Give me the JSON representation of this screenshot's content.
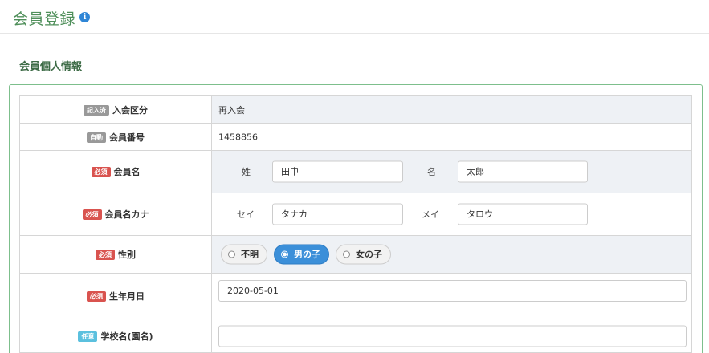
{
  "header": {
    "title": "会員登録",
    "info_icon": "info-icon"
  },
  "section": {
    "title": "会員個人情報"
  },
  "rows": {
    "member_type": {
      "badge": "記入済",
      "label": "入会区分",
      "value": "再入会"
    },
    "member_no": {
      "badge": "自動",
      "label": "会員番号",
      "value": "1458856"
    },
    "name": {
      "badge": "必須",
      "label": "会員名",
      "last_label": "姓",
      "last_value": "田中",
      "first_label": "名",
      "first_value": "太郎"
    },
    "kana": {
      "badge": "必須",
      "label": "会員名カナ",
      "last_label": "セイ",
      "last_value": "タナカ",
      "first_label": "メイ",
      "first_value": "タロウ"
    },
    "gender": {
      "badge": "必須",
      "label": "性別",
      "options": [
        "不明",
        "男の子",
        "女の子"
      ],
      "selected": "男の子"
    },
    "birthday": {
      "badge": "必須",
      "label": "生年月日",
      "value": "2020-05-01"
    },
    "school": {
      "badge": "任意",
      "label": "学校名(園名)",
      "value": ""
    }
  },
  "colors": {
    "title_green": "#4f8f5a",
    "required_red": "#d9534f",
    "optional_cyan": "#5bc0de",
    "filled_gray": "#999999",
    "selected_blue": "#3b8fd9"
  }
}
